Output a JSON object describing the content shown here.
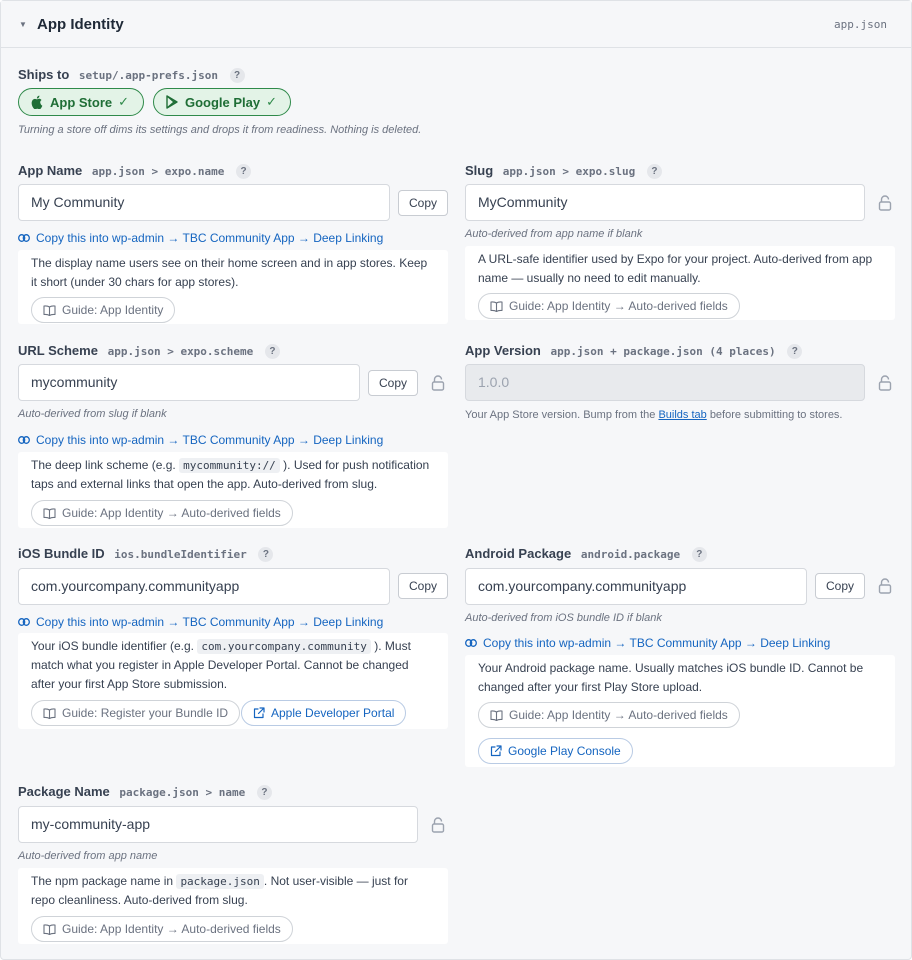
{
  "header": {
    "title": "App Identity",
    "file": "app.json"
  },
  "ships_to": {
    "label": "Ships to",
    "path": "setup/.app-prefs.json",
    "stores": [
      {
        "label": "App Store",
        "check": "✓"
      },
      {
        "label": "Google Play",
        "check": "✓"
      }
    ],
    "note": "Turning a store off dims its settings and drops it from readiness. Nothing is deleted."
  },
  "common": {
    "copy_label": "Copy",
    "help_mark": "?",
    "deep_link_text": "Copy this into wp-admin → TBC Community App → Deep Linking",
    "guide_auto": "Guide: App Identity → Auto-derived fields"
  },
  "app_name": {
    "label": "App Name",
    "path": "app.json > expo.name",
    "value": "My Community",
    "help": "The display name users see on their home screen and in app stores. Keep it short (under 30 chars for app stores).",
    "guide": "Guide: App Identity"
  },
  "slug": {
    "label": "Slug",
    "path": "app.json > expo.slug",
    "value": "MyCommunity",
    "note": "Auto-derived from app name if blank",
    "help": "A URL-safe identifier used by Expo for your project. Auto-derived from app name — usually no need to edit manually."
  },
  "url_scheme": {
    "label": "URL Scheme",
    "path": "app.json > expo.scheme",
    "value": "mycommunity",
    "note": "Auto-derived from slug if blank",
    "help_before": "The deep link scheme (e.g.",
    "help_code": "mycommunity://",
    "help_after": "). Used for push notification taps and external links that open the app. Auto-derived from slug."
  },
  "app_version": {
    "label": "App Version",
    "path": "app.json + package.json (4 places)",
    "value": "1.0.0",
    "note_before": "Your App Store version. Bump from the",
    "note_link": "Builds tab",
    "note_after": "before submitting to stores."
  },
  "ios_bundle": {
    "label": "iOS Bundle ID",
    "path": "ios.bundleIdentifier",
    "value": "com.yourcompany.communityapp",
    "help_before": "Your iOS bundle identifier (e.g.",
    "help_code": "com.yourcompany.community",
    "help_after": "). Must match what you register in Apple Developer Portal. Cannot be changed after your first App Store submission.",
    "guide": "Guide: Register your Bundle ID",
    "external": "Apple Developer Portal"
  },
  "android_package": {
    "label": "Android Package",
    "path": "android.package",
    "value": "com.yourcompany.communityapp",
    "note": "Auto-derived from iOS bundle ID if blank",
    "help": "Your Android package name. Usually matches iOS bundle ID. Cannot be changed after your first Play Store upload.",
    "external": "Google Play Console"
  },
  "package_name": {
    "label": "Package Name",
    "path": "package.json > name",
    "value": "my-community-app",
    "note": "Auto-derived from app name",
    "help_before": "The npm package name in",
    "help_code": "package.json",
    "help_after": ". Not user-visible — just for repo cleanliness. Auto-derived from slug."
  }
}
